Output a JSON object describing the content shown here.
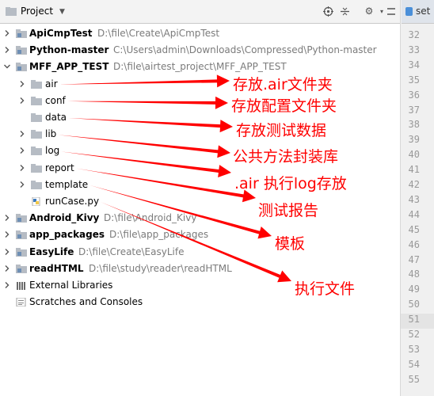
{
  "toolbar": {
    "title": "Project",
    "icons": [
      "target-icon",
      "collapse-icon",
      "gear-icon",
      "hide-icon"
    ]
  },
  "editor_tab": {
    "label": "set"
  },
  "tree": [
    {
      "name": "ApiCmpTest",
      "path": "D:\\file\\Create\\ApiCmpTest",
      "kind": "folder",
      "bold": true,
      "expanded": false,
      "level": 0
    },
    {
      "name": "Python-master",
      "path": "C:\\Users\\admin\\Downloads\\Compressed\\Python-master",
      "kind": "folder",
      "bold": true,
      "expanded": false,
      "level": 0
    },
    {
      "name": "MFF_APP_TEST",
      "path": "D:\\file\\airtest_project\\MFF_APP_TEST",
      "kind": "folder",
      "bold": true,
      "expanded": true,
      "level": 0
    },
    {
      "name": "air",
      "path": "",
      "kind": "folder",
      "bold": false,
      "expanded": false,
      "level": 1
    },
    {
      "name": "conf",
      "path": "",
      "kind": "folder",
      "bold": false,
      "expanded": false,
      "level": 1
    },
    {
      "name": "data",
      "path": "",
      "kind": "folder",
      "bold": false,
      "expanded": null,
      "level": 1
    },
    {
      "name": "lib",
      "path": "",
      "kind": "folder",
      "bold": false,
      "expanded": false,
      "level": 1
    },
    {
      "name": "log",
      "path": "",
      "kind": "folder",
      "bold": false,
      "expanded": false,
      "level": 1
    },
    {
      "name": "report",
      "path": "",
      "kind": "folder",
      "bold": false,
      "expanded": false,
      "level": 1
    },
    {
      "name": "template",
      "path": "",
      "kind": "folder",
      "bold": false,
      "expanded": false,
      "level": 1
    },
    {
      "name": "runCase.py",
      "path": "",
      "kind": "python",
      "bold": false,
      "expanded": null,
      "level": 1
    },
    {
      "name": "Android_Kivy",
      "path": "D:\\file\\Android_Kivy",
      "kind": "folder",
      "bold": true,
      "expanded": false,
      "level": 0
    },
    {
      "name": "app_packages",
      "path": "D:\\file\\app_packages",
      "kind": "folder",
      "bold": true,
      "expanded": false,
      "level": 0
    },
    {
      "name": "EasyLife",
      "path": "D:\\file\\Create\\EasyLife",
      "kind": "folder",
      "bold": true,
      "expanded": false,
      "level": 0
    },
    {
      "name": "readHTML",
      "path": "D:\\file\\study\\reader\\readHTML",
      "kind": "folder",
      "bold": true,
      "expanded": false,
      "level": 0
    },
    {
      "name": "External Libraries",
      "path": "",
      "kind": "libraries",
      "bold": false,
      "expanded": false,
      "level": 0
    },
    {
      "name": "Scratches and Consoles",
      "path": "",
      "kind": "scratches",
      "bold": false,
      "expanded": null,
      "level": 0
    }
  ],
  "line_numbers": [
    "32",
    "33",
    "34",
    "35",
    "36",
    "37",
    "38",
    "39",
    "40",
    "41",
    "42",
    "43",
    "44",
    "45",
    "46",
    "47",
    "48",
    "49",
    "50",
    "51",
    "52",
    "53",
    "54",
    "55"
  ],
  "current_line": "51",
  "annotations": [
    {
      "text": "存放.air文件夹",
      "target": "air"
    },
    {
      "text": "存放配置文件夹",
      "target": "conf"
    },
    {
      "text": "存放测试数据",
      "target": "data"
    },
    {
      "text": "公共方法封装库",
      "target": "lib"
    },
    {
      "text": ".air 执行log存放",
      "target": "log"
    },
    {
      "text": "测试报告",
      "target": "report"
    },
    {
      "text": "模板",
      "target": "template"
    },
    {
      "text": "执行文件",
      "target": "runCase.py"
    }
  ],
  "colors": {
    "annotation": "#ff0000",
    "folder": "#b6bcc4",
    "path": "#7b7b7b"
  }
}
